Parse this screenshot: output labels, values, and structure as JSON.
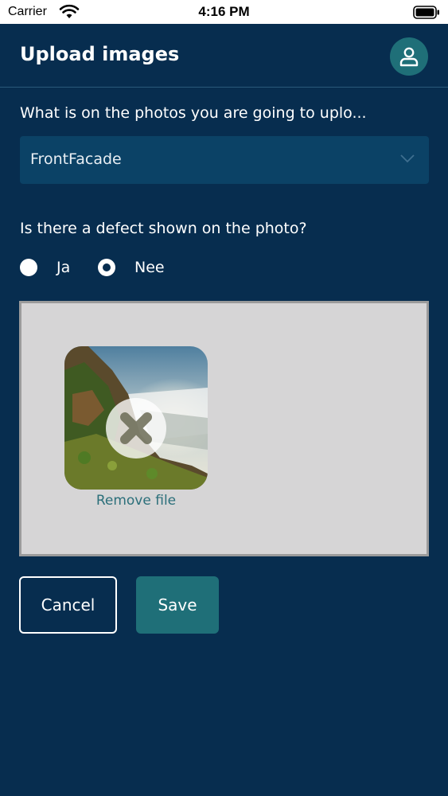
{
  "status_bar": {
    "carrier": "Carrier",
    "time": "4:16 PM"
  },
  "header": {
    "title": "Upload images",
    "profile_icon": "user-icon"
  },
  "photo_subject": {
    "question": "What is on the photos you are going to uplo...",
    "selected_value": "FrontFacade"
  },
  "defect": {
    "question": "Is there a defect shown on the photo?",
    "options": [
      {
        "label": "Ja",
        "selected": false
      },
      {
        "label": "Nee",
        "selected": true
      }
    ]
  },
  "upload": {
    "remove_label": "Remove file"
  },
  "actions": {
    "cancel_label": "Cancel",
    "save_label": "Save"
  },
  "colors": {
    "background": "#072d4f",
    "accent": "#1f6f78",
    "select_bg": "#0b4266",
    "dropzone_bg": "#d6d5d6",
    "link": "#2b6f7a"
  }
}
